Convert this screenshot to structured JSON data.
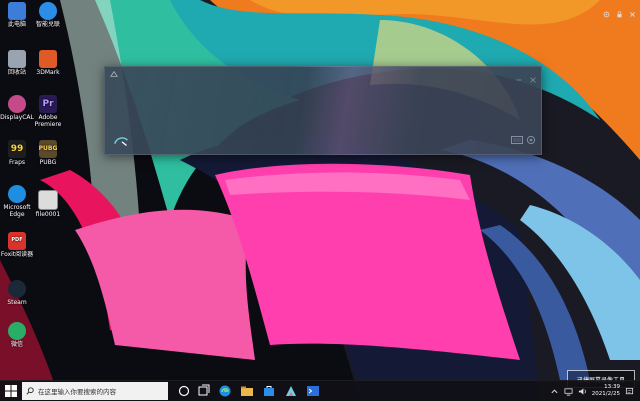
{
  "desktop": {
    "icons": [
      {
        "label": "此电脑",
        "glyph": "▭",
        "color": "#3b7dd8"
      },
      {
        "label": "智能兑联",
        "glyph": "◉",
        "color": "#2b8de8"
      },
      {
        "label": "回收站",
        "glyph": "♻",
        "color": "#9aa4b0"
      },
      {
        "label": "3DMark",
        "glyph": "3D",
        "color": "#e05a28"
      },
      {
        "label": "DisplayCAL",
        "glyph": "◐",
        "color": "#c54a8a"
      },
      {
        "label": "Adobe Premiere",
        "glyph": "Pr",
        "color": "#2a1a55"
      },
      {
        "label": "Fraps",
        "glyph": "99",
        "color": "#1e1e1e"
      },
      {
        "label": "PUBG",
        "glyph": "PG",
        "color": "#5a4a2a"
      },
      {
        "label": "Microsoft Edge",
        "glyph": "e",
        "color": "#1f8de0"
      },
      {
        "label": "file0001",
        "glyph": "▤",
        "color": "#dcdcdc"
      },
      {
        "label": "Foxit阅读器",
        "glyph": "PDF",
        "color": "#d9342b"
      },
      {
        "label": "Steam",
        "glyph": "S",
        "color": "#1b2838"
      },
      {
        "label": "微信",
        "glyph": "W",
        "color": "#2aae67"
      }
    ]
  },
  "search_window": {
    "title_icon": "app-logo-icon",
    "search_icon": "search-icon",
    "keyboard_icon": "keyboard-icon",
    "settings_icon": "settings-icon"
  },
  "taskbar": {
    "search_placeholder": "在这里输入你要搜索的内容",
    "items": [
      "task-view-icon",
      "edge-icon",
      "file-explorer-icon",
      "store-icon",
      "app-icon",
      "terminal-icon"
    ],
    "clock_time": "13:39",
    "clock_date": "2021/2/25"
  },
  "overlay": {
    "watermark": "迅捷屏幕录像工具"
  },
  "colors": {
    "taskbar_bg": "#101016",
    "accent": "#2b8de8"
  }
}
